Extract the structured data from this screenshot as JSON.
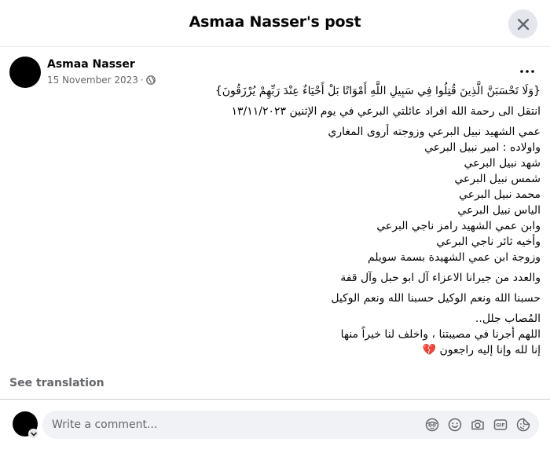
{
  "header": {
    "title": "Asmaa Nasser's post"
  },
  "post": {
    "author": "Asmaa Nasser",
    "date": "15 November 2023",
    "separator": "·",
    "lines": [
      "{وَلَا تَحْسَبَنَّ الَّذِينَ قُتِلُوا فِي سَبِيلِ اللَّهِ أَمْوَاتًا بَلْ أَحْيَاءٌ عِنْدَ رَبِّهِمْ يُرْزَقُونَ}",
      "انتقل الى رحمة الله افراد عائلتي البرعي في يوم الإثنين ١٣/١١/٢٠٢٣",
      "عمي الشهيد نبيل البرعي وزوجته أروى المغاري",
      "واولاده : امير نبيل البرعي",
      "شهد نبيل البرعي",
      "شمس نبيل البرعي",
      "محمد نبيل البرعي",
      "الياس نبيل البرعي",
      "وابن عمي الشهيد رامز ناجي البرعي",
      "وأخيه ثائر ناجي البرعي",
      "وزوجة ابن عمي الشهيدة بسمة سويلم",
      "والعدد من جيرانا الاعزاء آل ابو حبل وآل قفة",
      "حسبنا الله ونعم الوكيل حسبنا الله ونعم  الوكيل",
      "المُصاب جلل..",
      "اللهم أجرنا في مصيبتنا ، واخلف لنا خيراً منها",
      "إنا لله وإنا إليه راجعون 💔"
    ],
    "see_translation": "See translation"
  },
  "comment": {
    "placeholder": "Write a comment..."
  },
  "icons": {
    "close": "close-icon",
    "globe": "globe-icon",
    "more": "more-options-icon",
    "avatar_chevron": "chevron-down-icon",
    "comment_tools": [
      "avatar-sticker-icon",
      "emoji-icon",
      "camera-icon",
      "gif-icon",
      "sticker-icon"
    ]
  }
}
